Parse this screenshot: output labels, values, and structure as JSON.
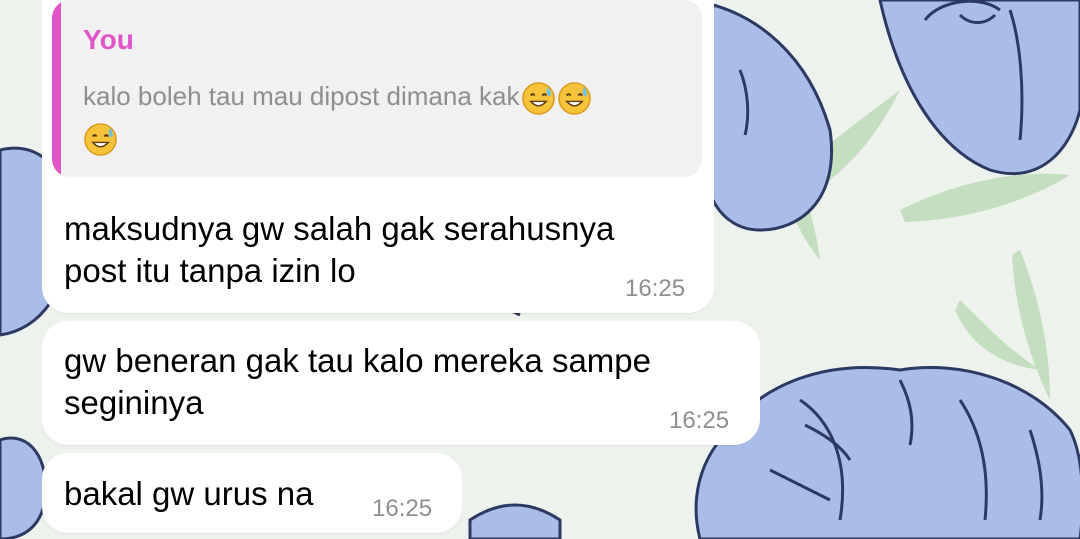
{
  "chat": {
    "reply_quote": {
      "author": "You",
      "text": "kalo boleh tau mau dipost dimana kak",
      "emoji_name": "grinning-face-with-sweat-emoji",
      "emoji_count": 3
    },
    "messages": [
      {
        "lines": [
          "maksudnya gw salah gak serahusnya",
          "post itu tanpa izin lo"
        ],
        "time": "16:25"
      },
      {
        "lines": [
          "gw beneran gak tau kalo mereka sampe",
          "segininya"
        ],
        "time": "16:25"
      },
      {
        "lines": [
          "bakal gw urus na"
        ],
        "time": "16:25"
      }
    ]
  },
  "colors": {
    "quote_accent": "#e055c8",
    "bubble_bg": "#ffffff",
    "quote_bg": "#f1f1f1",
    "timestamp": "#8e8e93",
    "wallpaper_flower": "#a9bde8",
    "wallpaper_leaf": "#bcdcb8"
  }
}
